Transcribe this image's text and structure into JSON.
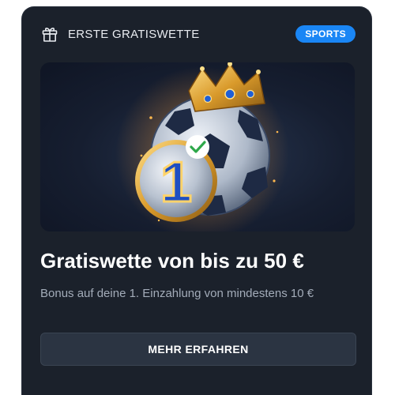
{
  "header": {
    "title": "ERSTE GRATISWETTE",
    "badge": "SPORTS",
    "icon": "gift-icon"
  },
  "hero": {
    "coin_number": "1",
    "check_icon": "check-icon",
    "crown_icon": "crown-icon"
  },
  "offer": {
    "headline": "Gratiswette von bis zu 50 €",
    "subline": "Bonus auf deine 1. Einzahlung von mindestens 10 €"
  },
  "cta": {
    "label": "MEHR ERFAHREN"
  },
  "colors": {
    "card_background": "#1b212b",
    "badge": "#1a86f5",
    "button": "#2b3442",
    "check": "#2ea84a"
  }
}
